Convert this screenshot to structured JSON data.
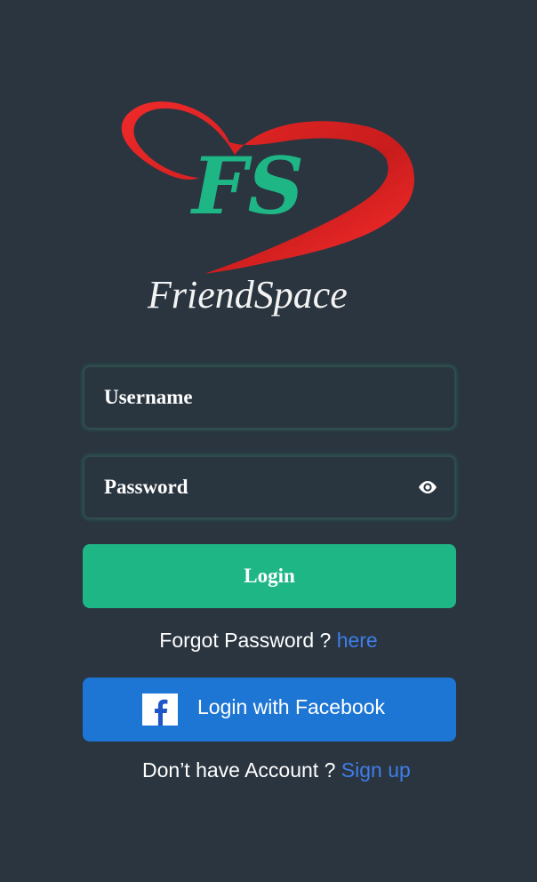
{
  "logo": {
    "monogram": "FS",
    "brand_name": "FriendSpace"
  },
  "form": {
    "username_placeholder": "Username",
    "password_placeholder": "Password",
    "login_label": "Login"
  },
  "forgot": {
    "text": "Forgot Password ? ",
    "link": "here"
  },
  "facebook": {
    "label": "Login with Facebook",
    "icon_glyph": "f"
  },
  "signup": {
    "text": "Don’t have Account ? ",
    "link": "Sign up"
  },
  "icons": {
    "password_toggle": "eye-icon",
    "facebook": "facebook-icon"
  },
  "colors": {
    "background": "#2a3540",
    "accent_green": "#1fb686",
    "heart_red": "#e52222",
    "facebook_blue": "#1e76d4",
    "link_blue": "#3e7ee8",
    "field_border": "#304c4c"
  }
}
